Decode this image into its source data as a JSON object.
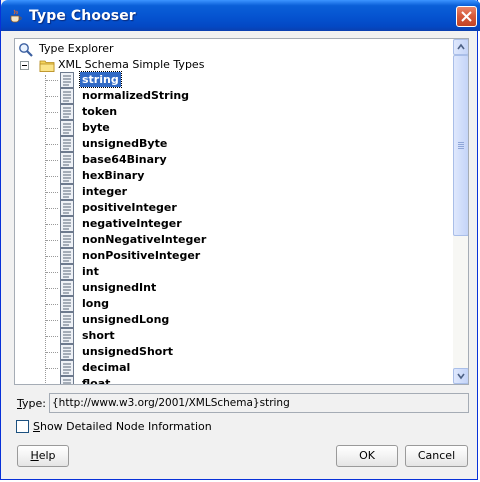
{
  "window": {
    "title": "Type Chooser"
  },
  "tree": {
    "root_label": "Type Explorer",
    "folder_label": "XML Schema Simple Types",
    "selected": "string",
    "items": [
      "string",
      "normalizedString",
      "token",
      "byte",
      "unsignedByte",
      "base64Binary",
      "hexBinary",
      "integer",
      "positiveInteger",
      "negativeInteger",
      "nonNegativeInteger",
      "nonPositiveInteger",
      "int",
      "unsignedInt",
      "long",
      "unsignedLong",
      "short",
      "unsignedShort",
      "decimal",
      "float"
    ]
  },
  "type_field": {
    "label": "Type:",
    "value": "{http://www.w3.org/2001/XMLSchema}string"
  },
  "options": {
    "show_detailed_label": "Show Detailed Node Information",
    "show_detailed_checked": false
  },
  "buttons": {
    "help": "Help",
    "ok": "OK",
    "cancel": "Cancel"
  },
  "colors": {
    "titlebar": "#0553d0",
    "selection": "#316ac5",
    "close": "#d65b3c"
  }
}
